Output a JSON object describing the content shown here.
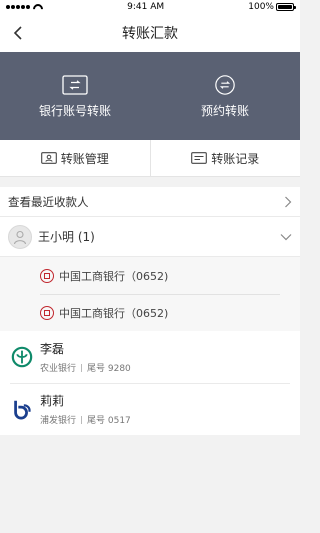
{
  "status_bar": {
    "time": "9:41 AM",
    "battery": "100%"
  },
  "nav": {
    "title": "转账汇款"
  },
  "hero": [
    {
      "label": "银行账号转账",
      "icon": "card-transfer-icon"
    },
    {
      "label": "预约转账",
      "icon": "clock-transfer-icon"
    }
  ],
  "tools": [
    {
      "label": "转账管理",
      "icon": "id-card-icon"
    },
    {
      "label": "转账记录",
      "icon": "record-icon"
    }
  ],
  "recent": {
    "title": "查看最近收款人",
    "group": {
      "name": "王小明",
      "count": "(1)",
      "accounts": [
        {
          "bank": "中国工商银行（0652)"
        },
        {
          "bank": "中国工商银行（0652)"
        }
      ]
    },
    "payees": [
      {
        "name": "李磊",
        "bank": "农业银行",
        "tail": "尾号 9280",
        "logo": "abc-bank-logo"
      },
      {
        "name": "莉莉",
        "bank": "浦发银行",
        "tail": "尾号 0517",
        "logo": "spdb-bank-logo"
      }
    ]
  },
  "colors": {
    "hero_bg": "#5a6173",
    "icbc_red": "#c0262d",
    "abc_green": "#0f8a6a",
    "spdb_blue": "#1b3f8e"
  }
}
